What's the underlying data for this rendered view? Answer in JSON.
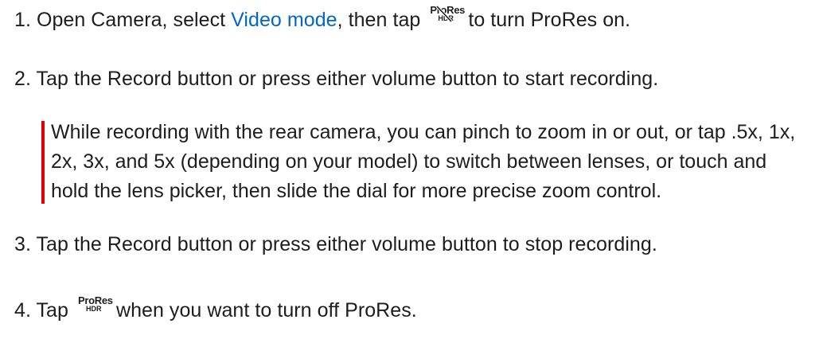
{
  "steps": [
    {
      "number": "1.",
      "before": "Open Camera, select ",
      "link": "Video mode",
      "middle": ", then tap ",
      "icon": {
        "name": "prores-hdr-off-icon",
        "top": "ProRes",
        "bottom": "HDR"
      },
      "after": " to turn ProRes on."
    },
    {
      "number": "2.",
      "text": "Tap the Record button or press either volume button to start recording."
    },
    {
      "number": "3.",
      "text": "Tap the Record button or press either volume button to stop recording."
    },
    {
      "number": "4.",
      "before": "Tap ",
      "icon": {
        "name": "prores-hdr-icon",
        "top": "ProRes",
        "bottom": "HDR"
      },
      "after": " when you want to turn off ProRes."
    }
  ],
  "note": {
    "lines": [
      "While recording with the rear camera, you can pinch to zoom in or out, or tap .5x, 1x,",
      "2x, 3x, and 5x (depending on your model) to switch between lenses, or touch and",
      "hold the lens picker, then slide the dial for more precise zoom control."
    ],
    "accent_color": "#e30000"
  },
  "colors": {
    "text": "#1d1d1f",
    "link": "#0066cc"
  }
}
